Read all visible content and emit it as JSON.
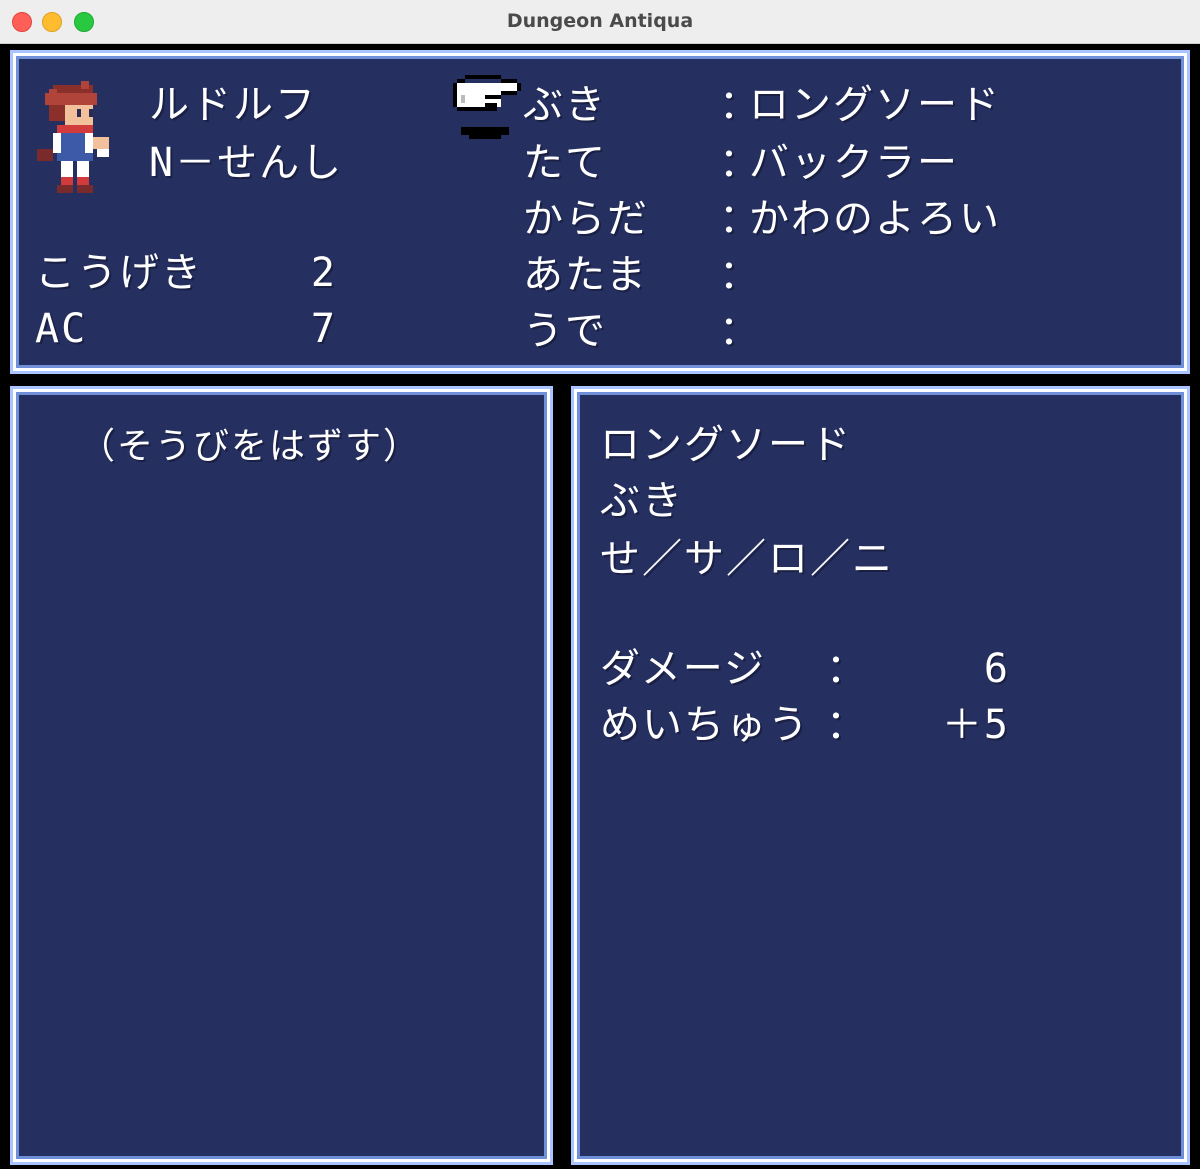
{
  "window": {
    "title": "Dungeon Antiqua"
  },
  "character": {
    "name": "ルドルフ",
    "class": "N－せんし",
    "stats": [
      {
        "label": "こうげき",
        "value": "2"
      },
      {
        "label": "AC",
        "value": "7"
      }
    ]
  },
  "equipment": [
    {
      "slot": "ぶき",
      "sep": "：",
      "item": "ロングソード"
    },
    {
      "slot": "たて",
      "sep": "：",
      "item": "バックラー"
    },
    {
      "slot": "からだ",
      "sep": "：",
      "item": "かわのよろい"
    },
    {
      "slot": "あたま",
      "sep": "：",
      "item": ""
    },
    {
      "slot": "うで",
      "sep": "：",
      "item": ""
    }
  ],
  "item_list": [
    "（そうびをはずす）"
  ],
  "item_info": {
    "name": "ロングソード",
    "type": "ぶき",
    "classes": "せ／サ／ロ／ニ",
    "stats": [
      {
        "label": "ダメージ",
        "sep": "：",
        "value": "6"
      },
      {
        "label": "めいちゅう",
        "sep": "：",
        "value": "＋5"
      }
    ]
  },
  "colors": {
    "panel_bg": "#253060",
    "panel_border": "#a9c4ff",
    "text": "#ffffff"
  },
  "icons": {
    "cursor": "pointing-hand-icon",
    "portrait": "hero-sprite-icon"
  }
}
